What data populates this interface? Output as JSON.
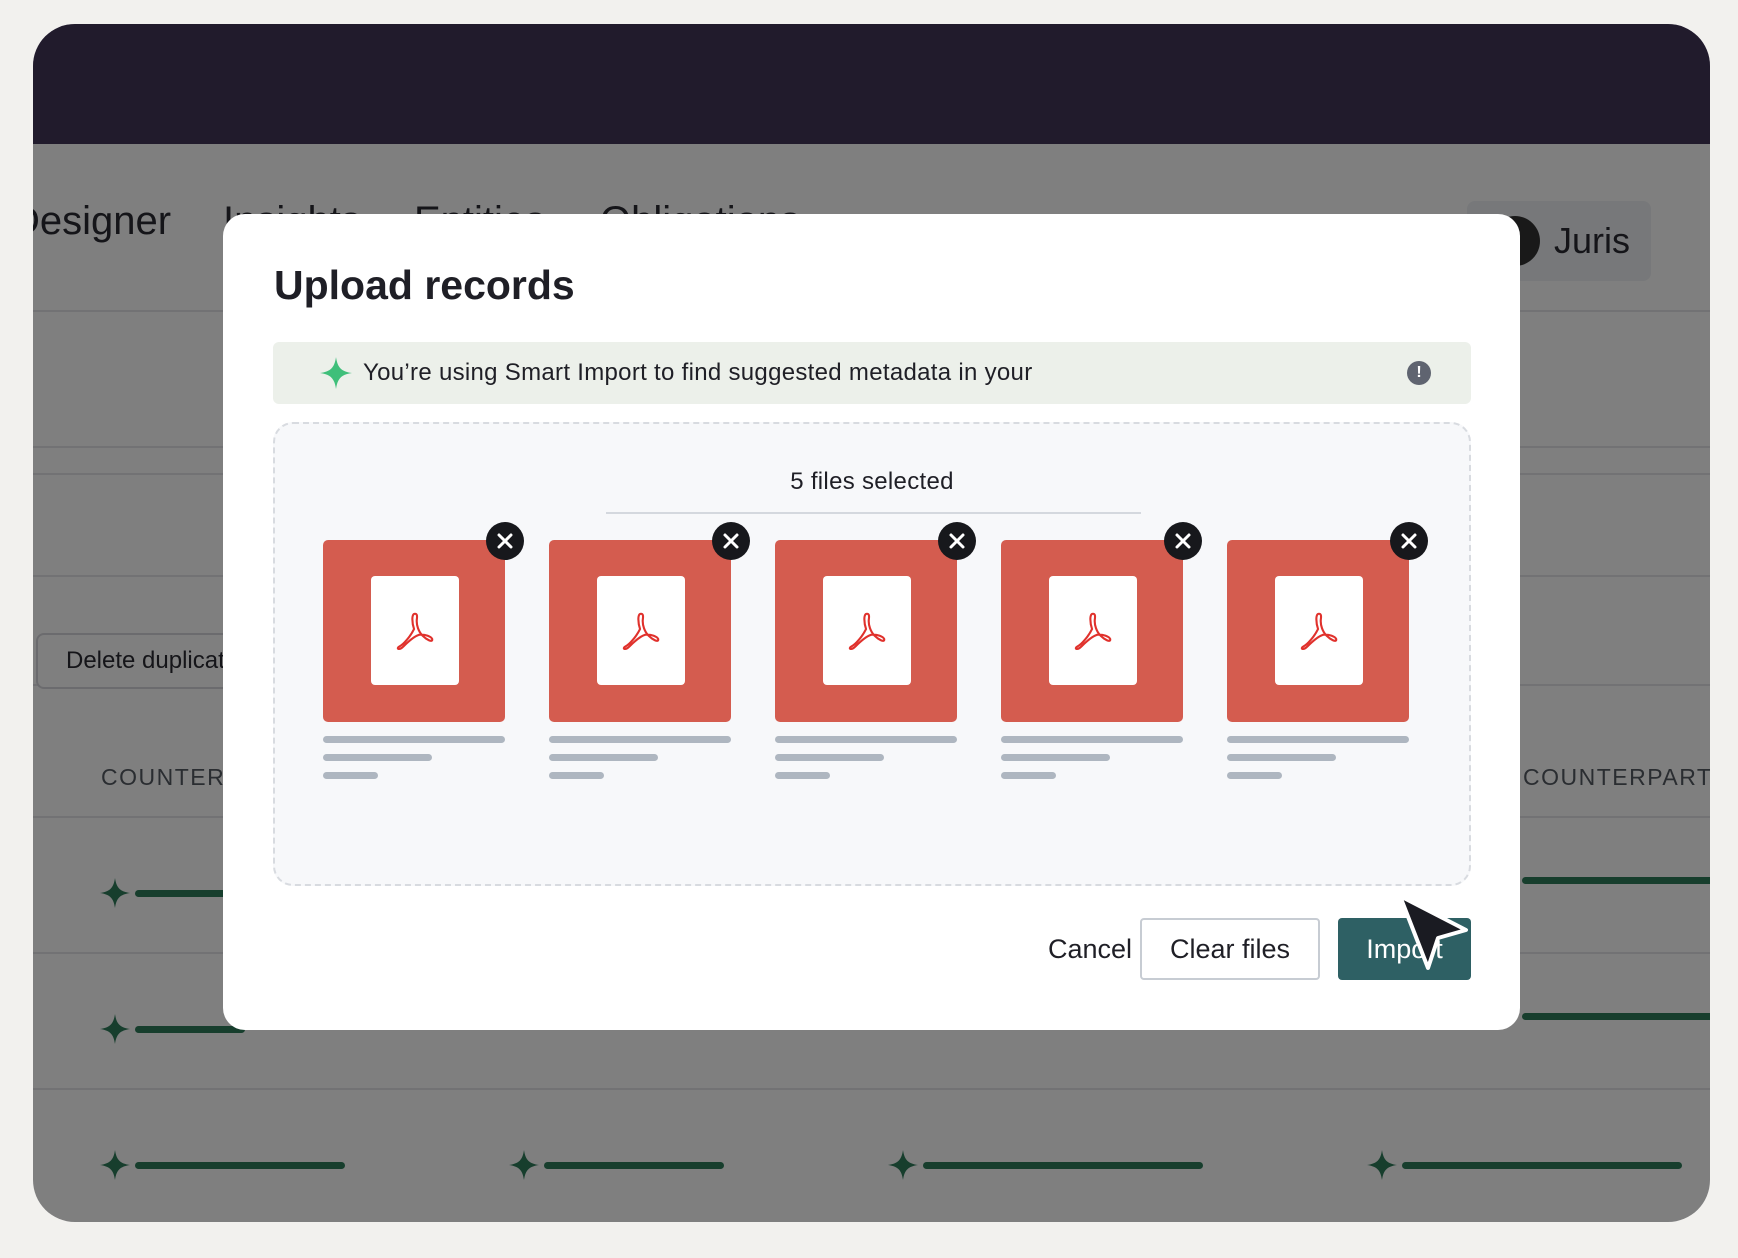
{
  "colors": {
    "header_bg": "#433759",
    "accent_green": "#2f7d5b",
    "pdf_red": "#d45c4f",
    "primary_button": "#2e6064"
  },
  "nav": {
    "tabs": [
      {
        "label": "Designer"
      },
      {
        "label": "Insights"
      },
      {
        "label": "Entities"
      },
      {
        "label": "Obligations"
      }
    ],
    "user_name": "Juris"
  },
  "background": {
    "delete_button_label": "Delete duplicates",
    "columns": [
      "COUNTERPARTY",
      "COUNTERPARTY SIG"
    ]
  },
  "modal": {
    "title": "Upload records",
    "notice_text": "You’re using Smart Import to find suggested metadata in your",
    "notice_icons": [
      "sparkle-icon",
      "info-icon"
    ],
    "files_selected": "5 files selected",
    "file_count": 5,
    "file_icon": "pdf-icon",
    "remove_icon": "close-icon",
    "cancel_label": "Cancel",
    "clear_label": "Clear files",
    "import_label": "Import"
  }
}
